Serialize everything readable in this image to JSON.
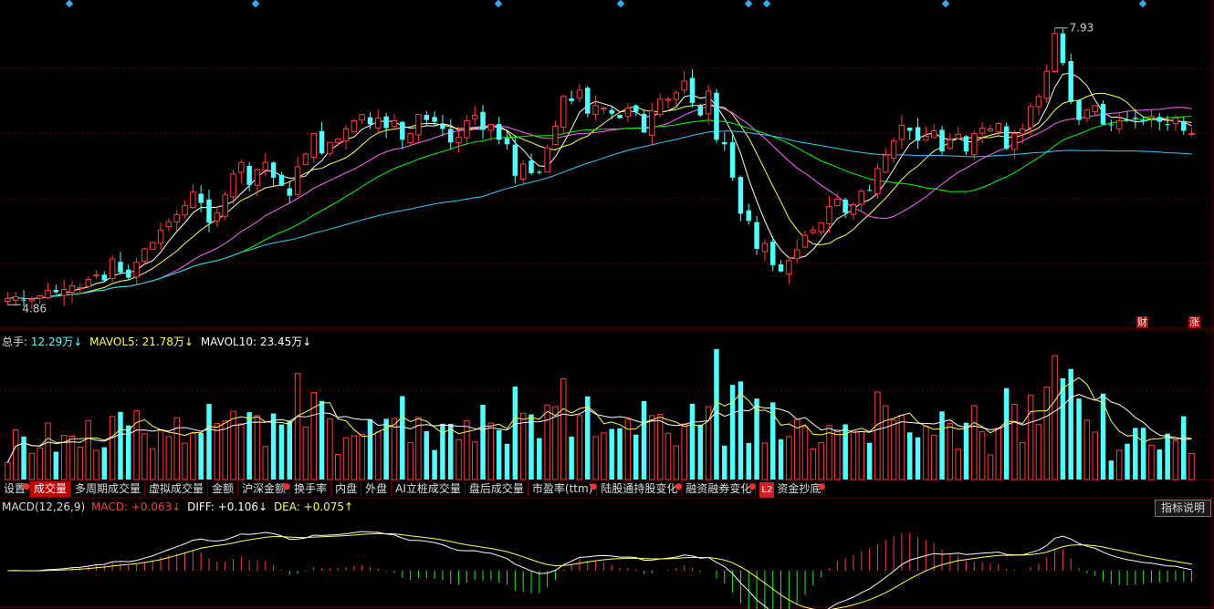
{
  "colors": {
    "up": "#ff3c3c",
    "down": "#54ffff",
    "ma5": "#ffffff",
    "ma10": "#ffff55",
    "ma20": "#ff66ff",
    "ma30": "#00ff00",
    "ma60": "#33ccff",
    "grid": "#5a0000",
    "pos": "#ff3c3c",
    "neg": "#22ee22",
    "diff": "#ffffff",
    "dea": "#ffff55"
  },
  "price_panel": {
    "high_label": "7.93",
    "low_label": "4.86"
  },
  "flags": {
    "cai": "财",
    "zhang": "涨"
  },
  "volume_legend": {
    "total_label": "总手:",
    "total_value": "12.29万↓",
    "mavol5_label": "MAVOL5:",
    "mavol5_value": "21.78万↓",
    "mavol10_label": "MAVOL10:",
    "mavol10_value": "23.45万↓"
  },
  "tabs": [
    "设置",
    "成交量",
    "多周期成交量",
    "虚拟成交量",
    "金额",
    "沪深金额",
    "换手率",
    "内盘",
    "外盘",
    "AI立桩成交量",
    "盘后成交量",
    "市盈率(ttm)",
    "陆股通持股变化",
    "融资融券变化",
    "资金抄底"
  ],
  "active_tab": "成交量",
  "l2_badge": "L2",
  "macd_legend": {
    "name": "MACD(12,26,9)",
    "macd_label": "MACD:",
    "macd_value": "+0.063↓",
    "diff_label": "DIFF:",
    "diff_value": "+0.106↓",
    "dea_label": "DEA:",
    "dea_value": "+0.075↑"
  },
  "explain_button": "指标说明",
  "chart_data": [
    {
      "type": "candlestick",
      "title": "",
      "ylim": [
        4.6,
        8.2
      ],
      "x": {
        "count": 148
      },
      "close": [
        4.93,
        4.95,
        4.91,
        4.92,
        4.96,
        5.02,
        5.0,
        5.03,
        5.07,
        5.05,
        5.14,
        5.19,
        5.13,
        5.37,
        5.22,
        5.16,
        5.33,
        5.48,
        5.55,
        5.69,
        5.78,
        5.86,
        5.96,
        6.11,
        5.99,
        5.77,
        5.88,
        6.08,
        6.31,
        6.44,
        6.19,
        6.36,
        6.44,
        6.27,
        6.18,
        6.07,
        6.39,
        6.53,
        6.76,
        6.54,
        6.66,
        6.7,
        6.81,
        6.9,
        6.97,
        6.86,
        6.93,
        6.82,
        6.9,
        6.69,
        6.76,
        6.97,
        6.91,
        6.89,
        6.81,
        6.66,
        6.72,
        6.9,
        6.96,
        6.8,
        6.86,
        6.69,
        6.64,
        6.29,
        6.42,
        6.32,
        6.33,
        6.6,
        6.84,
        7.17,
        7.12,
        7.24,
        6.98,
        7.07,
        7.04,
        6.98,
        6.93,
        7.04,
        7.0,
        6.77,
        7.01,
        7.14,
        7.14,
        7.21,
        7.34,
        7.1,
        6.96,
        7.23,
        6.69,
        6.64,
        6.27,
        5.87,
        5.79,
        5.48,
        5.54,
        5.3,
        5.23,
        5.35,
        5.47,
        5.63,
        5.69,
        5.77,
        5.95,
        6.03,
        5.88,
        5.97,
        6.12,
        6.13,
        6.37,
        6.52,
        6.68,
        6.85,
        6.79,
        6.68,
        6.73,
        6.79,
        6.56,
        6.69,
        6.75,
        6.56,
        6.76,
        6.82,
        6.81,
        6.87,
        6.59,
        6.76,
        6.81,
        7.06,
        7.17,
        7.45,
        7.87,
        7.54,
        7.11,
        6.91,
        7.02,
        7.07,
        6.86,
        6.85,
        6.9,
        6.9,
        6.93,
        6.9,
        6.95,
        6.89,
        6.86,
        6.93,
        6.79,
        6.76
      ]
    },
    {
      "type": "bar",
      "title": "成交量",
      "unit": "万",
      "series": [
        {
          "name": "MAVOL5",
          "value": 21.78
        },
        {
          "name": "MAVOL10",
          "value": 23.45
        }
      ],
      "last_value": 12.29
    },
    {
      "type": "bar",
      "title": "MACD(12,26,9)",
      "series": [
        {
          "name": "MACD",
          "last": 0.063
        },
        {
          "name": "DIFF",
          "last": 0.106
        },
        {
          "name": "DEA",
          "last": 0.075
        }
      ]
    }
  ]
}
